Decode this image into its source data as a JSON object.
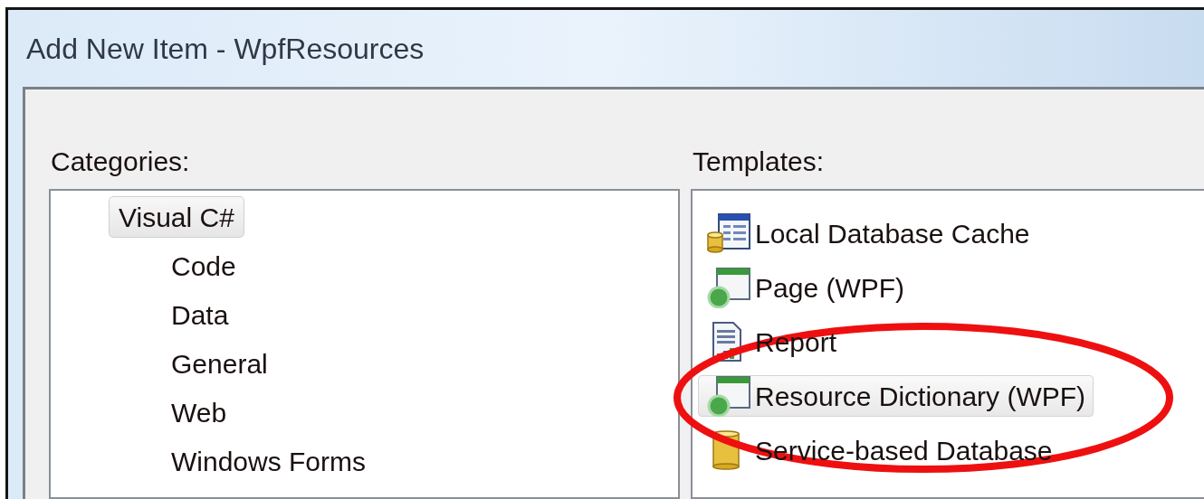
{
  "window": {
    "title": "Add New Item - WpfResources"
  },
  "categories": {
    "label": "Categories:",
    "tree": [
      {
        "label": "Visual C#",
        "selected": true,
        "children": [
          {
            "label": "Code",
            "selected": false
          },
          {
            "label": "Data",
            "selected": false
          },
          {
            "label": "General",
            "selected": false
          },
          {
            "label": "Web",
            "selected": false
          },
          {
            "label": "Windows Forms",
            "selected": false
          }
        ]
      }
    ]
  },
  "templates": {
    "label": "Templates:",
    "items": [
      {
        "label": "Local Database Cache",
        "kind": "cache",
        "selected": false
      },
      {
        "label": "Page (WPF)",
        "kind": "wpf",
        "selected": false
      },
      {
        "label": "Report",
        "kind": "report",
        "selected": false
      },
      {
        "label": "Resource Dictionary (WPF)",
        "kind": "wpf",
        "selected": true
      },
      {
        "label": "Service-based Database",
        "kind": "database",
        "selected": false
      }
    ]
  }
}
